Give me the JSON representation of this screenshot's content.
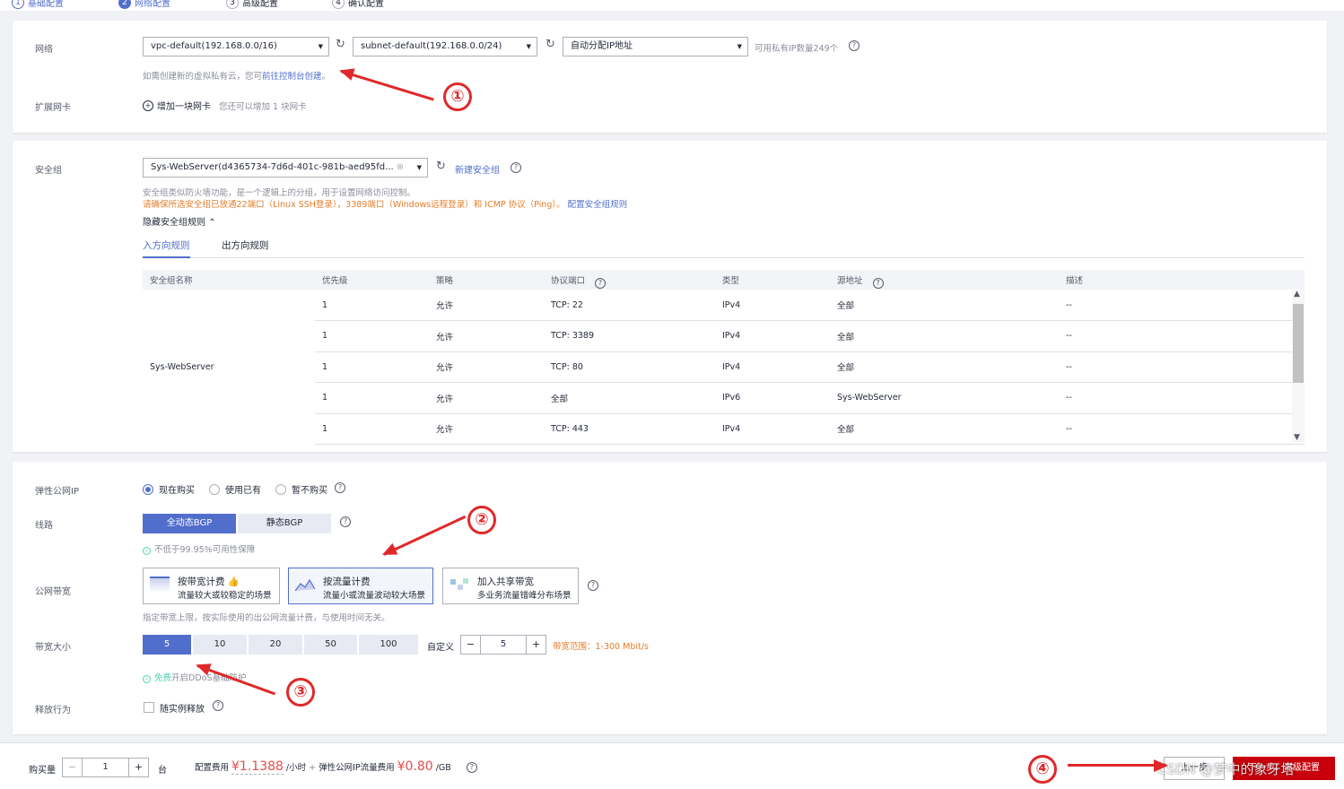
{
  "steps": [
    {
      "num": "1",
      "label": "基础配置"
    },
    {
      "num": "2",
      "label": "网络配置"
    },
    {
      "num": "3",
      "label": "高级配置"
    },
    {
      "num": "4",
      "label": "确认配置"
    }
  ],
  "network": {
    "label": "网络",
    "vpc_value": "vpc-default(192.168.0.0/16)",
    "subnet_value": "subnet-default(192.168.0.0/24)",
    "ip_value": "自动分配IP地址",
    "ip_count": "可用私有IP数量249个",
    "hint_prefix": "如需创建新的虚拟私有云，您可",
    "hint_link": "前往控制台创建",
    "hint_suffix": "。",
    "ext_label": "扩展网卡",
    "add_nic": "增加一块网卡",
    "add_nic_hint": "您还可以增加 1 块网卡"
  },
  "security": {
    "label": "安全组",
    "value": "Sys-WebServer(d4365734-7d6d-401c-981b-aed95fd...",
    "new_link": "新建安全组",
    "desc": "安全组类似防火墙功能，是一个逻辑上的分组，用于设置网络访问控制。",
    "warn": "请确保所选安全组已放通22端口（Linux SSH登录），3389端口（Windows远程登录）和 ICMP 协议（Ping）。",
    "config_link": "配置安全组规则",
    "hide_rules": "隐藏安全组规则",
    "tab_in": "入方向规则",
    "tab_out": "出方向规则",
    "columns": [
      "安全组名称",
      "优先级",
      "策略",
      "协议端口",
      "类型",
      "源地址",
      "描述"
    ],
    "group_name": "Sys-WebServer",
    "rows": [
      {
        "priority": "1",
        "policy": "允许",
        "port": "TCP: 22",
        "type": "IPv4",
        "source": "全部",
        "desc": "--"
      },
      {
        "priority": "1",
        "policy": "允许",
        "port": "TCP: 3389",
        "type": "IPv4",
        "source": "全部",
        "desc": "--"
      },
      {
        "priority": "1",
        "policy": "允许",
        "port": "TCP: 80",
        "type": "IPv4",
        "source": "全部",
        "desc": "--"
      },
      {
        "priority": "1",
        "policy": "允许",
        "port": "全部",
        "type": "IPv6",
        "source": "Sys-WebServer",
        "desc": "--"
      },
      {
        "priority": "1",
        "policy": "允许",
        "port": "TCP: 443",
        "type": "IPv4",
        "source": "全部",
        "desc": "--"
      }
    ]
  },
  "eip": {
    "label": "弹性公网IP",
    "opt_buy": "现在购买",
    "opt_use": "使用已有",
    "opt_none": "暂不购买",
    "line_label": "线路",
    "line_dynamic": "全动态BGP",
    "line_static": "静态BGP",
    "sla": "不低于99.95%可用性保障",
    "bw_label": "公网带宽",
    "bill_bw_title": "按带宽计费",
    "bill_bw_desc": "流量较大或较稳定的场景",
    "bill_traffic_title": "按流量计费",
    "bill_traffic_desc": "流量小或流量波动较大场景",
    "bill_share_title": "加入共享带宽",
    "bill_share_desc": "多业务流量错峰分布场景",
    "bill_hint": "指定带宽上限，按实际使用的出公网流量计费，与使用时间无关。",
    "size_label": "带宽大小",
    "sizes": [
      "5",
      "10",
      "20",
      "50",
      "100"
    ],
    "custom_label": "自定义",
    "custom_value": "5",
    "range": "带宽范围：1-300 Mbit/s",
    "ddos_free": "免费",
    "ddos_text": "开启DDoS基础防护",
    "release_label": "释放行为",
    "release_text": "随实例释放"
  },
  "footer": {
    "qty_label": "购买量",
    "qty_value": "1",
    "qty_unit": "台",
    "fee_label": "配置费用",
    "fee_value": "¥1.1388",
    "fee_unit": "/小时",
    "plus": "+",
    "traffic_label": "弹性公网IP流量费用",
    "traffic_value": "¥0.80",
    "traffic_unit": "/GB",
    "prev_btn": "上一步",
    "next_btn": "下一步：高级配置",
    "watermark": "CSDN @梦中的象牙塔"
  },
  "annotations": [
    "①",
    "②",
    "③",
    "④"
  ],
  "colors": {
    "accent": "#526ecc",
    "warn": "#e37d29",
    "price": "#e34c4c",
    "annotation": "#e0282a",
    "next_button": "#c7000b"
  }
}
